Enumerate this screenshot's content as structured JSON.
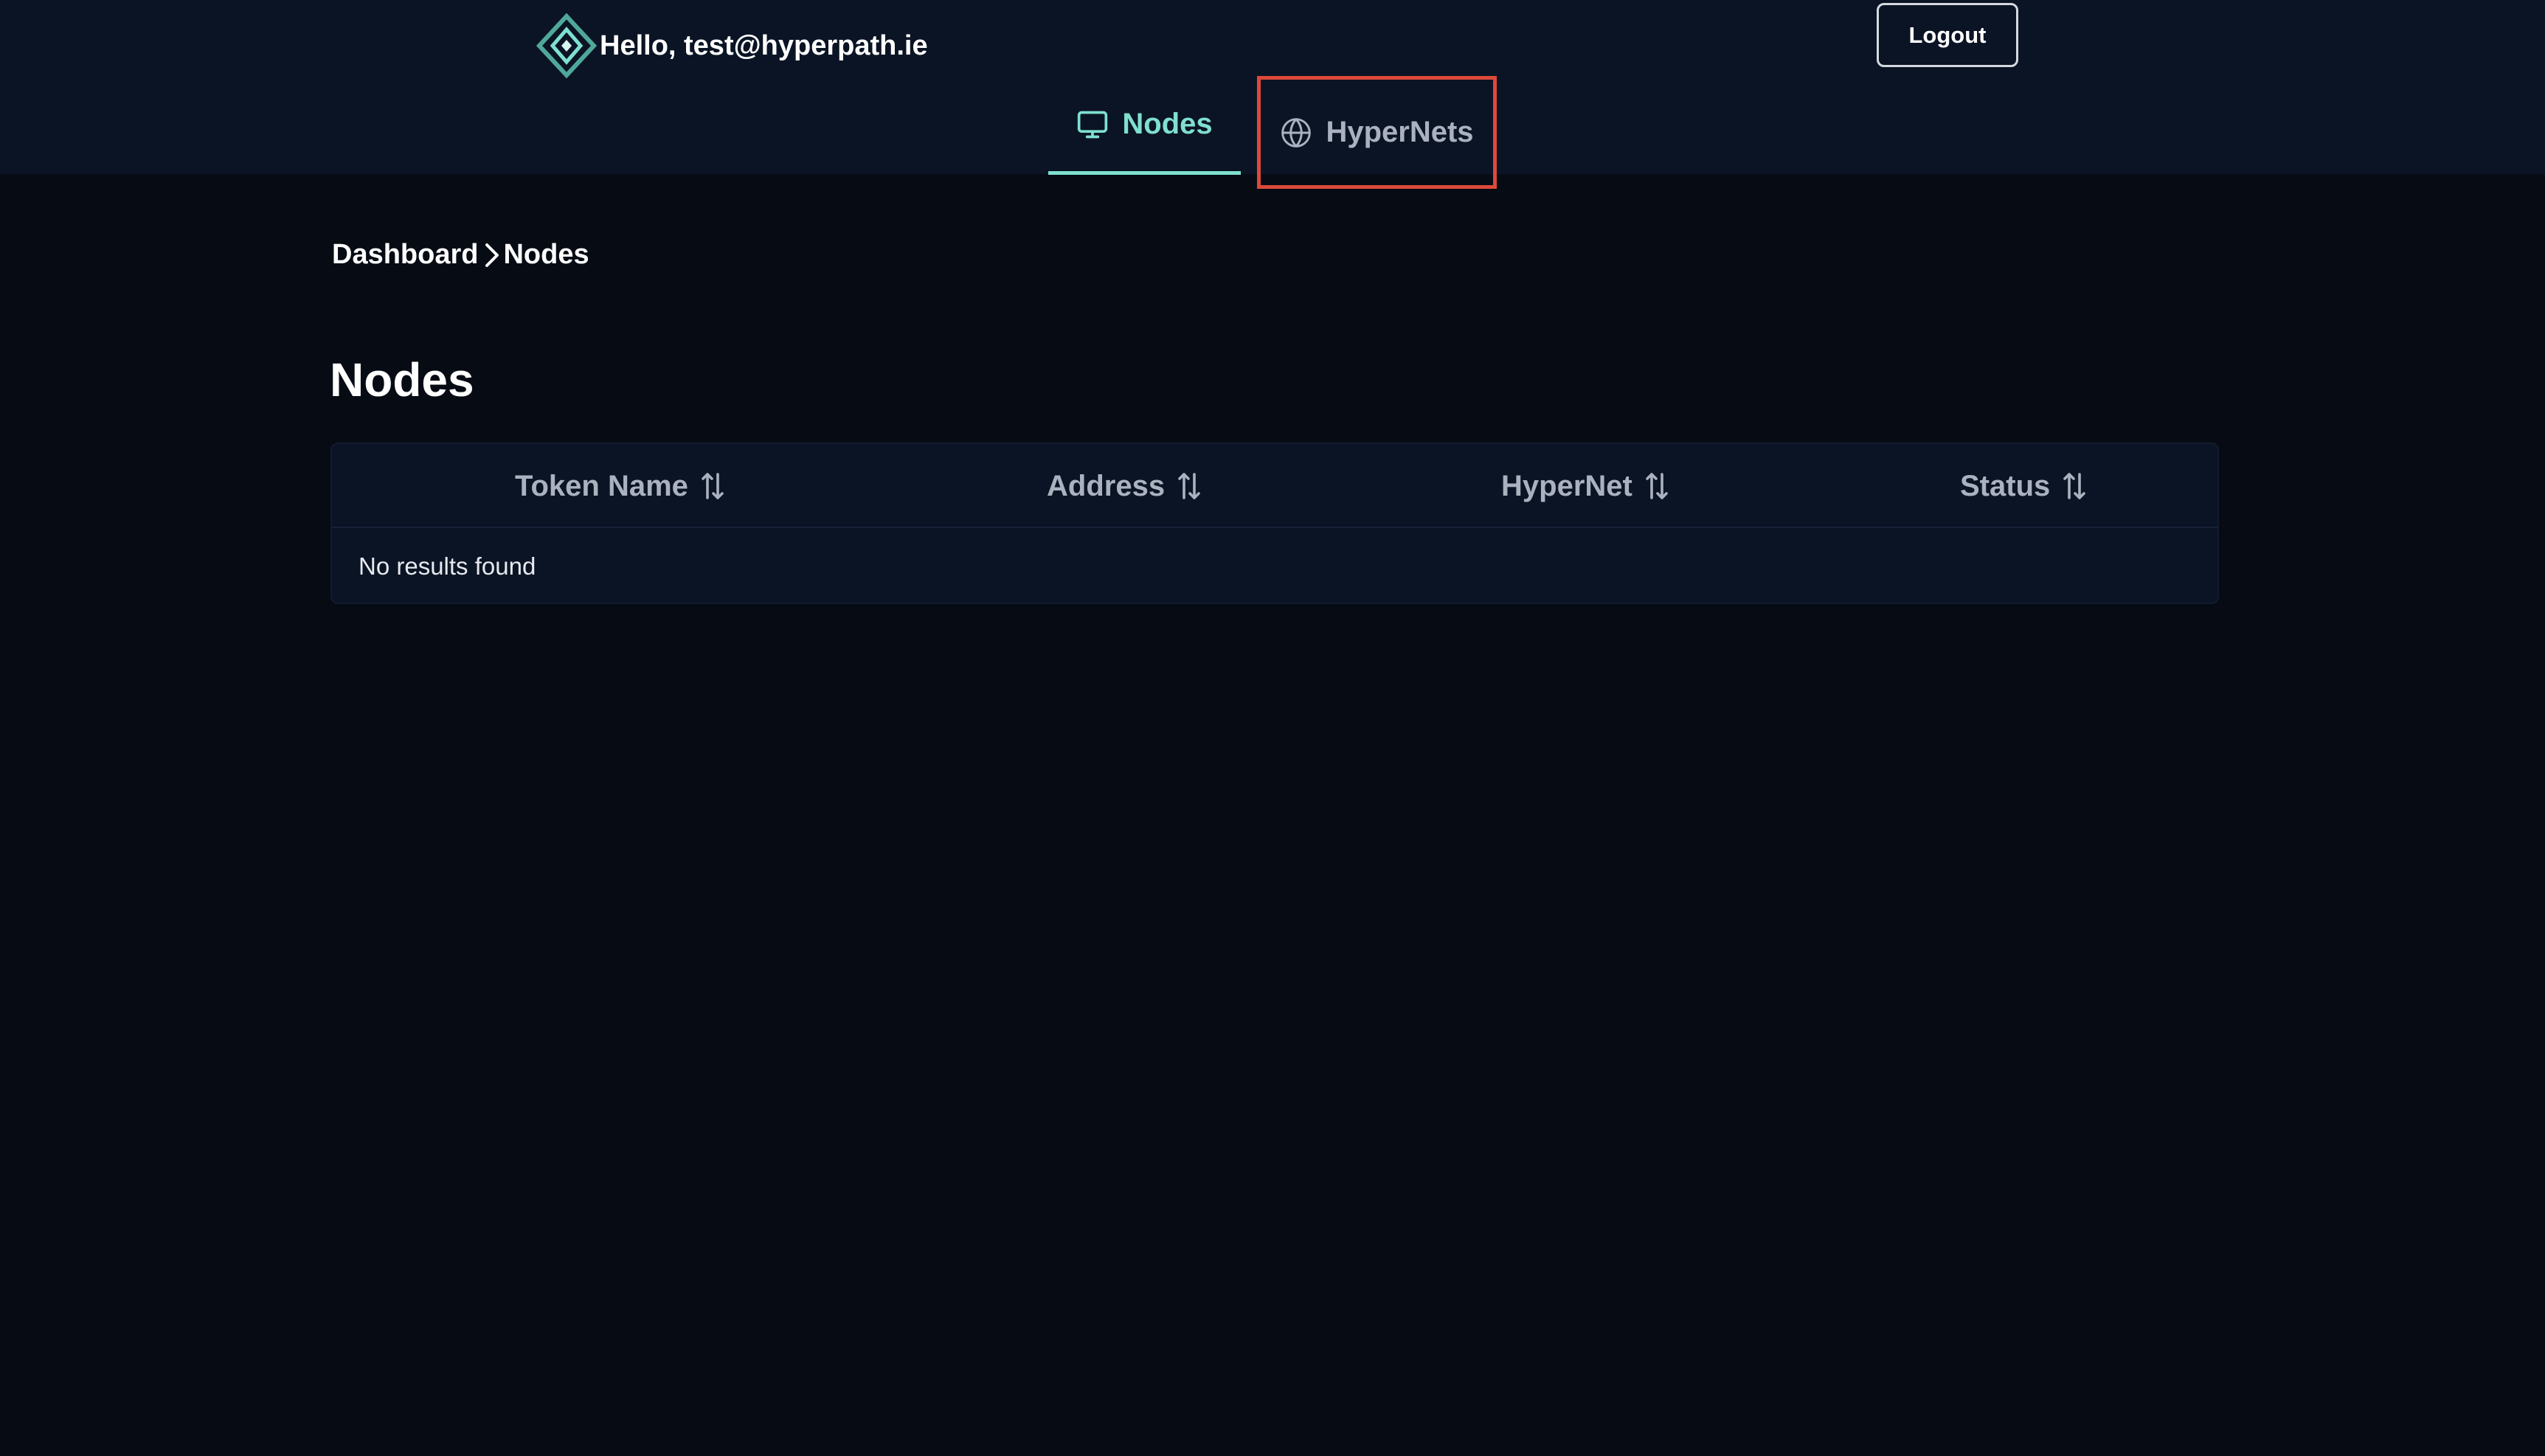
{
  "header": {
    "greeting": "Hello, test@hyperpath.ie",
    "logout_label": "Logout"
  },
  "tabs": [
    {
      "label": "Nodes",
      "icon": "monitor-icon",
      "active": true
    },
    {
      "label": "HyperNets",
      "icon": "globe-icon",
      "active": false
    }
  ],
  "breadcrumb": {
    "items": [
      "Dashboard",
      "Nodes"
    ]
  },
  "page": {
    "title": "Nodes"
  },
  "table": {
    "columns": [
      "Token Name",
      "Address",
      "HyperNet",
      "Status"
    ],
    "empty_message": "No results found"
  },
  "colors": {
    "accent": "#7fe0cf",
    "background": "#060b14",
    "header_background": "#0b1424",
    "highlight_box": "#dc4a3a"
  }
}
